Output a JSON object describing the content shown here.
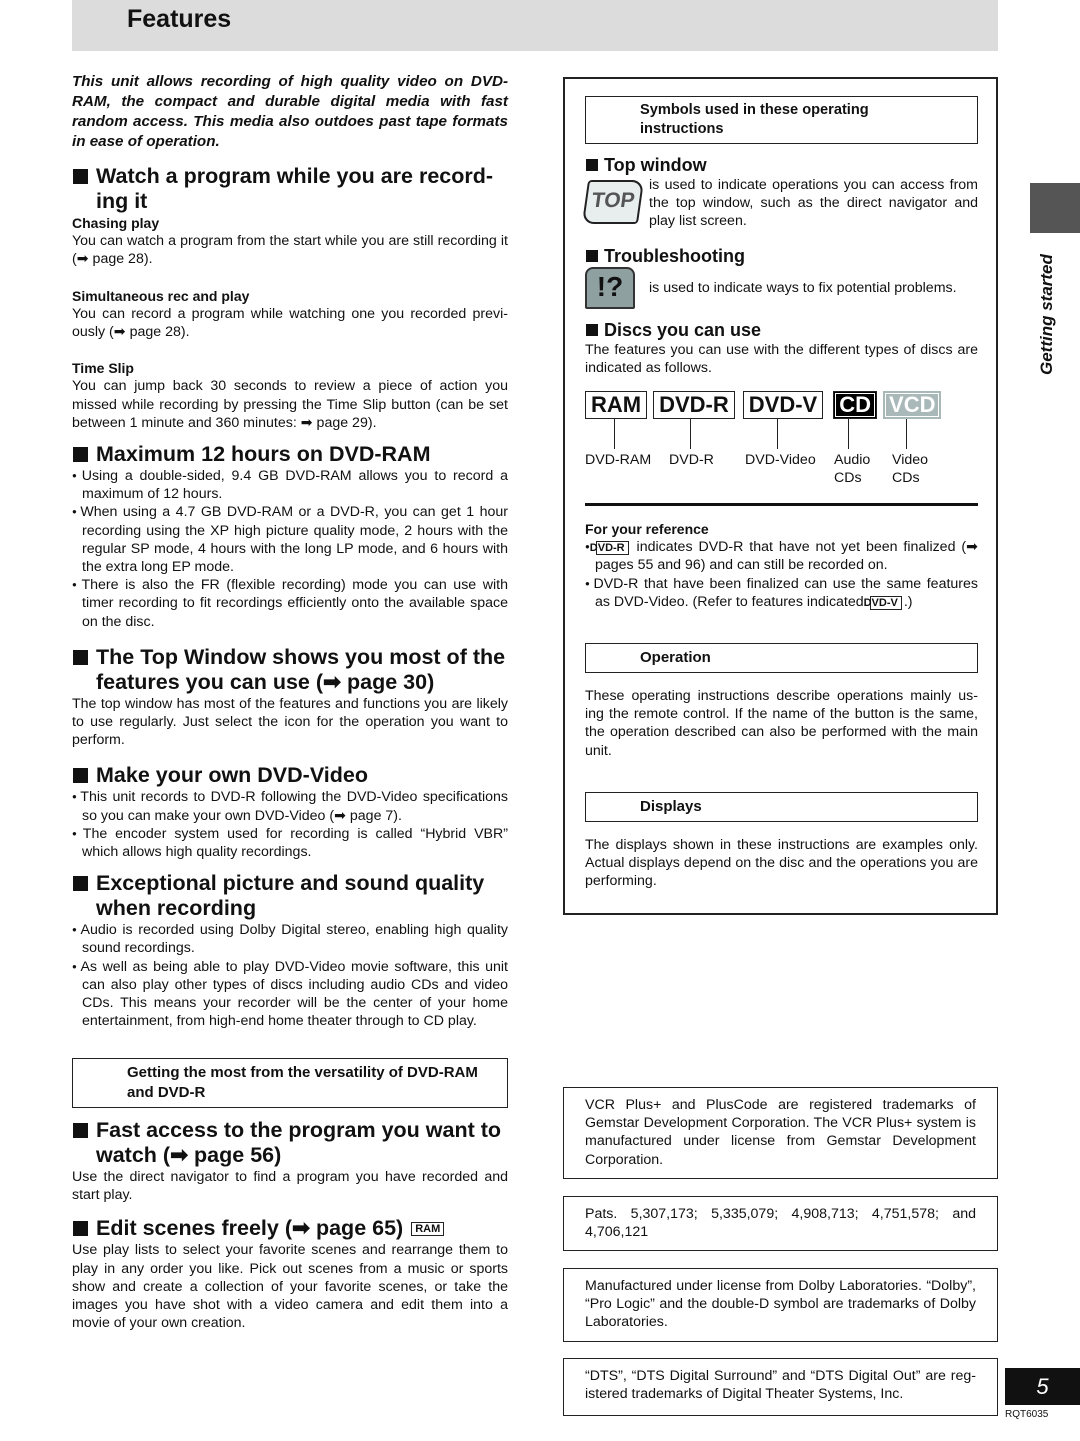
{
  "title": "Features",
  "left": {
    "intro": "This unit allows recording of high quality video on DVD-RAM, the compact and durable digital media with fast random access. This media also outdoes past tape formats in ease of operation.",
    "s1": {
      "heading": "Watch a program while you are record- ing it",
      "sub": [
        {
          "title": "Chasing play",
          "text": "You can watch a program from the start while you are still recording it (➡ page 28)."
        },
        {
          "title": "Simultaneous rec and play",
          "text": "You can record a program while watching one you recorded previ- ously (➡ page 28)."
        },
        {
          "title": "Time Slip",
          "text": "You can jump back 30 seconds to review a piece of action you missed while recording by pressing the Time Slip button (can be set between 1 minute and 360 minutes: ➡ page 29)."
        }
      ]
    },
    "s2": {
      "heading": "Maximum 12 hours on DVD-RAM",
      "bullets": [
        "Using a double-sided, 9.4 GB DVD-RAM allows you to record a maximum of 12 hours.",
        "When using a 4.7 GB DVD-RAM or a DVD-R, you can get 1 hour recording using the XP high picture quality mode, 2 hours with the regular SP mode, 4 hours with the long LP mode, and 6 hours with the extra long EP mode.",
        "There is also the FR (flexible recording) mode you can use with timer recording to fit recordings efficiently onto the available space on the disc."
      ]
    },
    "s3": {
      "heading": "The Top Window shows you most of the features you can use (➡ page 30)",
      "text": "The top window has most of the features and functions you are likely to use regularly. Just select the icon for the operation you want to perform."
    },
    "s4": {
      "heading": "Make your own DVD-Video",
      "bullets": [
        "This unit records to DVD-R following the DVD-Video specifications so you can make your own DVD-Video (➡ page 7).",
        "The encoder system used for recording is called “Hybrid VBR” which allows high quality recordings."
      ]
    },
    "s5": {
      "heading": "Exceptional picture and sound quality when recording",
      "bullets": [
        "Audio is recorded using Dolby Digital stereo, enabling high quality sound recordings.",
        "As well as being able to play DVD-Video movie software, this unit can also play other types of discs including audio CDs and video CDs. This means your recorder will be the center of your home entertainment, from high-end home theater through to CD play."
      ]
    },
    "box": "Getting the most from the versatility of DVD-RAM and DVD-R",
    "s6": {
      "heading": "Fast access to the program you want to watch (➡ page 56)",
      "text": "Use the direct navigator to find a program you have recorded and start play."
    },
    "s7": {
      "heading": "Edit scenes freely (➡ page 65)",
      "tag": "RAM",
      "text": "Use play lists to select your favorite scenes and rearrange them to play in any order you like. Pick out scenes from a music or sports show and create a collection of your favorite scenes, or take the images you have shot with a video camera and edit them into a movie of your own creation."
    }
  },
  "right": {
    "symbols_box": "Symbols used in these operating instructions",
    "top": {
      "heading": "Top window",
      "icon": "TOP",
      "text": "is used to indicate operations you can access from the top window, such as the direct navigator and play list screen."
    },
    "trouble": {
      "heading": "Troubleshooting",
      "icon": "!?",
      "text": "is used to indicate ways to fix potential problems."
    },
    "discs": {
      "heading": "Discs you can use",
      "text": "The features you can use with the different types of discs are indicated as follows.",
      "items": [
        {
          "logo": "RAM",
          "label": "DVD-RAM"
        },
        {
          "logo": "DVD-R",
          "label": "DVD-R"
        },
        {
          "logo": "DVD-V",
          "label": "DVD-Video"
        },
        {
          "logo": "CD",
          "label": "Audio CDs"
        },
        {
          "logo": "VCD",
          "label": "Video CDs"
        }
      ]
    },
    "reference": {
      "title": "For your reference",
      "b1_tag": "DVD-R",
      "b1": "indicates DVD-R that have not yet been finalized (➡ pages 55 and 96) and can still be recorded on.",
      "b2": "DVD-R that have been finalized can use the same features as DVD-Video. (Refer to features indicated",
      "b2_tag": "DVD-V",
      "b2_end": ".)"
    },
    "operation": {
      "box": "Operation",
      "text": "These operating instructions describe operations mainly us- ing the remote control. If the name of the button is the same, the operation described can also be performed with the main unit."
    },
    "displays": {
      "box": "Displays",
      "text": "The displays shown in these instructions are examples only. Actual displays depend on the disc and the operations you are performing."
    }
  },
  "notes": [
    "VCR Plus+ and PlusCode are registered trademarks of Gemstar Development Corporation. The VCR Plus+ system is manufactured under license from Gemstar Development Corporation.",
    "Pats. 5,307,173; 5,335,079; 4,908,713; 4,751,578; and 4,706,121",
    "Manufactured under license from Dolby Laboratories. “Dolby”, “Pro Logic” and the double-D symbol are trademarks of Dolby Laboratories.",
    "“DTS”, “DTS Digital Surround” and “DTS Digital Out” are reg- istered trademarks of Digital Theater Systems, Inc."
  ],
  "side_tab": "Getting started",
  "page_number": "5",
  "doc_code": "RQT6035",
  "colors": {
    "header_bg": "#dcdcdc",
    "side_tab": "#555555",
    "vcd": "#a9b8b8"
  }
}
